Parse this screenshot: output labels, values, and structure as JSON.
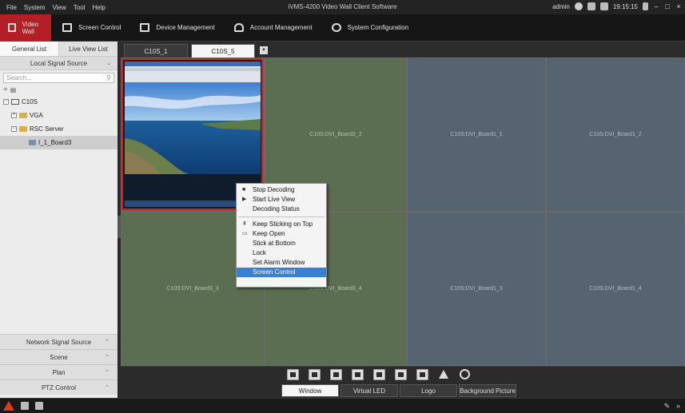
{
  "menu": [
    "File",
    "System",
    "View",
    "Tool",
    "Help"
  ],
  "app_title": "iVMS-4200 Video Wall Client Software",
  "title_right": {
    "user": "admin",
    "time": "19:15:15"
  },
  "toolbar": {
    "video_wall": "Video Wall",
    "screen_control": "Screen Control",
    "device_management": "Device Management",
    "account_management": "Account Management",
    "system_configuration": "System Configuration"
  },
  "left": {
    "tabs": [
      "General List",
      "Live View List"
    ],
    "local_signal_source": "Local Signal Source",
    "search_placeholder": "Search...",
    "tree": {
      "root": "C10S",
      "vga": "VGA",
      "rsc_server": "RSC Server",
      "board": "I_1_Board3"
    },
    "sections": [
      "Network Signal Source",
      "Scene",
      "Plan",
      "PTZ Control"
    ]
  },
  "screen_tabs": [
    "C10S_1",
    "C10S_5"
  ],
  "cells": {
    "board3_2": "C10S:DVI_Board3_2",
    "board1_1": "C10S:DVI_Board1_1",
    "board1_2": "C10S:DVI_Board1_2",
    "board3_3": "C10S:DVI_Board3_3",
    "board3_4": "C10S:DVI_Board3_4",
    "board1_3": "C10S:DVI_Board1_3",
    "board1_4": "C10S:DVI_Board1_4"
  },
  "context_menu": {
    "stop_decoding": "Stop Decoding",
    "start_live_view": "Start Live View",
    "decoding_status": "Decoding Status",
    "keep_sticking_on_top": "Keep Sticking on Top",
    "keep_open": "Keep Open",
    "stick_at_bottom": "Stick at Bottom",
    "lock": "Lock",
    "set_alarm_window": "Set Alarm Window",
    "screen_control": "Screen Control"
  },
  "bottom_tabs": [
    "Window",
    "Virtual LED",
    "Logo",
    "Background Picture"
  ],
  "colors": {
    "accent": "#b21f24",
    "selected_window_border": "#c8202a",
    "menu_highlight": "#3a7fd6",
    "cell_green": "#5c6e52",
    "cell_blue": "#566471"
  }
}
